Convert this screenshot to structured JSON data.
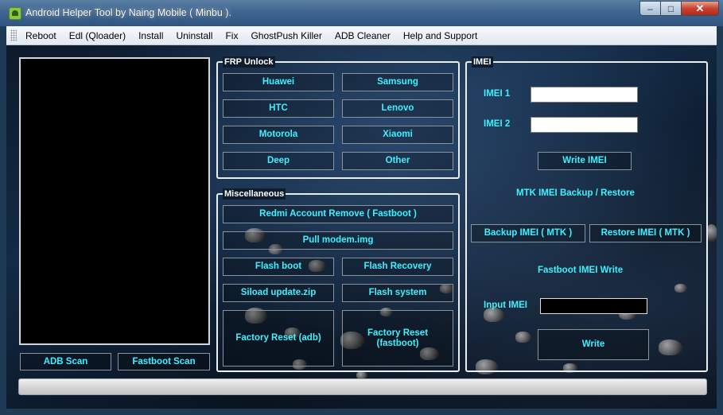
{
  "window": {
    "title": "Android Helper Tool by Naing Mobile ( Minbu ).",
    "controls": {
      "minimize": "–",
      "maximize": "□",
      "close": "✕"
    }
  },
  "menu": [
    "Reboot",
    "Edl (Qloader)",
    "Install",
    "Uninstall",
    "Fix",
    "GhostPush Killer",
    "ADB Cleaner",
    "Help and Support"
  ],
  "scan": {
    "adb_label": "ADB Scan",
    "fastboot_label": "Fastboot Scan"
  },
  "frp": {
    "title": "FRP Unlock",
    "buttons": [
      "Huawei",
      "Samsung",
      "HTC",
      "Lenovo",
      "Motorola",
      "Xiaomi",
      "Deep",
      "Other"
    ]
  },
  "misc": {
    "title": "Miscellaneous",
    "redmi": "Redmi Account Remove ( Fastboot )",
    "pull_modem": "Pull modem.img",
    "flash_boot": "Flash boot",
    "flash_recovery": "Flash Recovery",
    "siload": "Siload update.zip",
    "flash_system": "Flash system",
    "factory_adb": "Factory Reset (adb)",
    "factory_fastboot": "Factory Reset (fastboot)"
  },
  "imei": {
    "title": "IMEI",
    "imei1_label": "IMEI 1",
    "imei1_value": "",
    "imei2_label": "IMEI 2",
    "imei2_value": "",
    "write_imei": "Write IMEI",
    "mtk_heading": "MTK IMEI Backup / Restore",
    "backup_mtk": "Backup IMEI ( MTK )",
    "restore_mtk": "Restore IMEI ( MTK )",
    "fastboot_heading": "Fastboot IMEI Write",
    "input_label": "Input IMEI",
    "input_value": "",
    "write": "Write"
  },
  "status": {
    "progress": 0
  },
  "colors": {
    "button_text": "#3ff0ff",
    "background": "#0d1a2b",
    "group_border": "#e9eef3"
  }
}
